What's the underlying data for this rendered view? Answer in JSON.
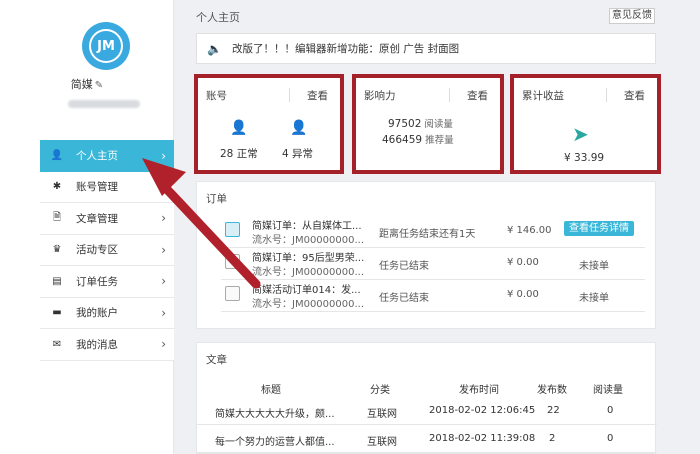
{
  "sidebar": {
    "avatar_text": "JM",
    "username": "简媒",
    "edit_icon": "edit-icon",
    "nav": [
      {
        "label": "个人主页",
        "icon": "user-icon",
        "glyph": "👤",
        "active": true
      },
      {
        "label": "账号管理",
        "icon": "asterisk-icon",
        "glyph": "✱",
        "active": false
      },
      {
        "label": "文章管理",
        "icon": "document-icon",
        "glyph": "🗎",
        "active": false
      },
      {
        "label": "活动专区",
        "icon": "crown-icon",
        "glyph": "♛",
        "active": false
      },
      {
        "label": "订单任务",
        "icon": "calendar-icon",
        "glyph": "▤",
        "active": false
      },
      {
        "label": "我的账户",
        "icon": "card-icon",
        "glyph": "▬",
        "active": false
      },
      {
        "label": "我的消息",
        "icon": "mail-icon",
        "glyph": "✉",
        "active": false
      }
    ]
  },
  "header": {
    "title": "个人主页",
    "feedback": "意见反馈"
  },
  "notice": {
    "text": "改版了！！！编辑器新增功能：原创 广告 封面图"
  },
  "cards": {
    "account": {
      "title": "账号",
      "link": "查看",
      "normal_count": "28",
      "normal_label": "正常",
      "abnormal_count": "4",
      "abnormal_label": "异常"
    },
    "influence": {
      "title": "影响力",
      "link": "查看",
      "reads": "97502",
      "reads_label": "阅读量",
      "recs": "466459",
      "recs_label": "推荐量"
    },
    "earnings": {
      "title": "累计收益",
      "link": "查看",
      "amount": "¥ 33.99"
    }
  },
  "orders": {
    "title": "订单",
    "rows": [
      {
        "line1": "简媒订单：从自媒体工...",
        "line2": "流水号：JM00000000...",
        "status": "距离任务结束还有1天",
        "price": "¥ 146.00",
        "action": "查看任务详情",
        "is_button": true
      },
      {
        "line1": "简媒订单：95后型男荣...",
        "line2": "流水号：JM00000000...",
        "status": "任务已结束",
        "price": "¥ 0.00",
        "action": "未接单",
        "is_button": false
      },
      {
        "line1": "简媒活动订单014：发...",
        "line2": "流水号：JM00000000...",
        "status": "任务已结束",
        "price": "¥ 0.00",
        "action": "未接单",
        "is_button": false
      }
    ]
  },
  "articles": {
    "title": "文章",
    "headers": [
      "标题",
      "分类",
      "发布时间",
      "发布数",
      "阅读量"
    ],
    "rows": [
      [
        "简媒大大大大大升级，颇...",
        "互联网",
        "2018-02-02 12:06:45",
        "22",
        "0"
      ],
      [
        "每一个努力的运营人都值...",
        "互联网",
        "2018-02-02 11:39:08",
        "2",
        "0"
      ]
    ]
  },
  "colors": {
    "accent": "#3ab7d8",
    "highlight": "#a5212a",
    "arrow": "#b0212b"
  }
}
